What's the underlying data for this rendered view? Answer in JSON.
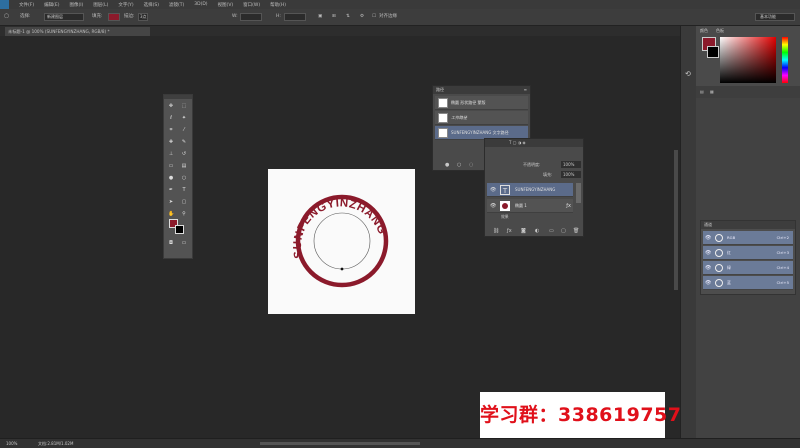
{
  "menubar": {
    "logo": "Ps",
    "items": [
      "文件(F)",
      "编辑(E)",
      "图像(I)",
      "图层(L)",
      "文字(Y)",
      "选择(S)",
      "滤镜(T)",
      "3D(D)",
      "视图(V)",
      "窗口(W)",
      "帮助(H)"
    ]
  },
  "options": {
    "mode_label": "选择:",
    "mode_value": "新建图层",
    "fill_label": "填充:",
    "stroke_label": "描边:",
    "stroke_width": "3点",
    "width_label": "W:",
    "height_label": "H:",
    "align_edges": "对齐边缘",
    "workspace": "基本功能"
  },
  "document": {
    "tab_title": "未标题-1 @ 100% (SUNFENGYINZHANG, RGB/8) *",
    "stamp_text": "SUNFENGYINZHANG",
    "stamp_color": "#8b1a2b"
  },
  "toolbox": {
    "foreground_color": "#8b1a2b",
    "background_color": "#000000"
  },
  "paths_panel": {
    "title": "路径",
    "items": [
      {
        "label": "椭圆  形状路径 蒙版"
      },
      {
        "label": "工作路径"
      },
      {
        "label": "SUNFENGYINZHANG 文字路径"
      }
    ]
  },
  "layers_panel": {
    "opacity_label": "不透明度:",
    "opacity_value": "100%",
    "fill_label": "填充:",
    "fill_value": "100%",
    "layers": [
      {
        "name": "SUNFENGYINZHANG",
        "kind": "text",
        "selected": true
      },
      {
        "name": "椭圆 1",
        "kind": "shape",
        "selected": false
      },
      {
        "name": "效果",
        "kind": "effect",
        "selected": false
      }
    ]
  },
  "color_panel": {
    "tabs": [
      "颜色",
      "色板"
    ]
  },
  "adjust_panel": {
    "title": "通道",
    "rows": [
      {
        "label": "RGB",
        "shortcut": "Ctrl+2"
      },
      {
        "label": "红",
        "shortcut": "Ctrl+3"
      },
      {
        "label": "绿",
        "shortcut": "Ctrl+4"
      },
      {
        "label": "蓝",
        "shortcut": "Ctrl+5"
      }
    ]
  },
  "statusbar": {
    "zoom": "100%",
    "doc_info": "文档:2.81M/1.02M"
  },
  "watermark": {
    "text": "学习群：338619757"
  }
}
